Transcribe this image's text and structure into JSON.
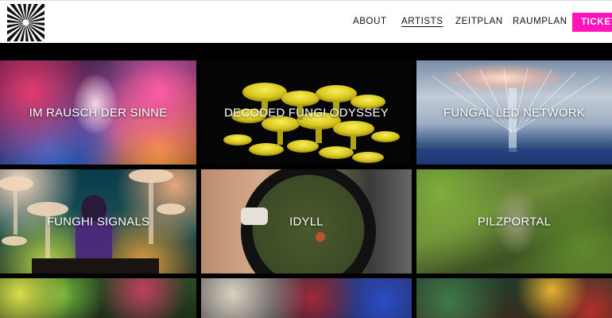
{
  "header": {
    "logo_name": "sunburst-logo",
    "nav": [
      {
        "label": "ABOUT",
        "active": false
      },
      {
        "label": "ARTISTS",
        "active": true
      },
      {
        "label": "ZEITPLAN",
        "active": false
      },
      {
        "label": "RAUMPLAN",
        "active": false
      }
    ],
    "tickets_label": "TICKETS",
    "tickets_color": "#ff14b9"
  },
  "gallery": {
    "cards": [
      {
        "title": "IM RAUSCH DER SINNE"
      },
      {
        "title": "DECODED FUNGI ODYSSEY"
      },
      {
        "title": "FUNGAL LED NETWORK"
      },
      {
        "title": "FUNGHI SIGNALS"
      },
      {
        "title": "IDYLL"
      },
      {
        "title": "PILZPORTAL"
      },
      {
        "title": ""
      },
      {
        "title": ""
      },
      {
        "title": ""
      }
    ]
  }
}
